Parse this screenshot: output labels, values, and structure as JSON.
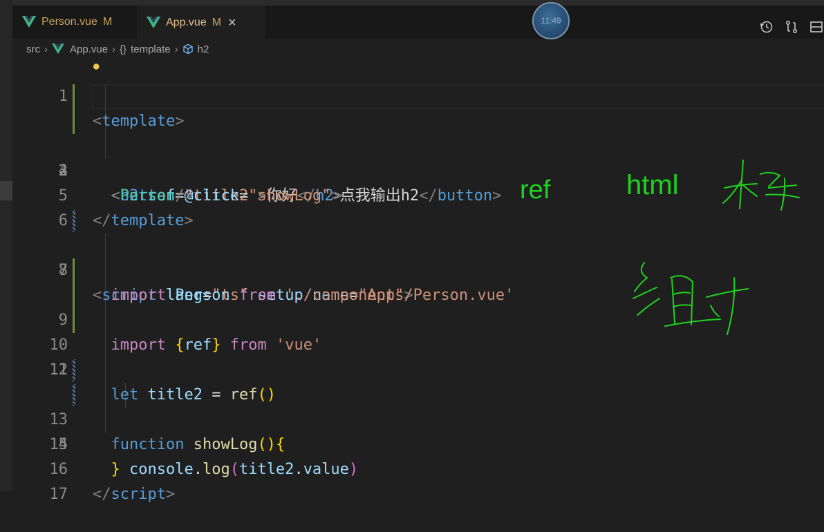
{
  "tabs": [
    {
      "name": "Person.vue",
      "status": "M",
      "active": false
    },
    {
      "name": "App.vue",
      "status": "M",
      "active": true,
      "close": "×"
    }
  ],
  "avatar_text": "11:49",
  "breadcrumb": {
    "folder": "src",
    "file": "App.vue",
    "node1": "template",
    "node1_icon": "{}",
    "node2": "h2"
  },
  "toolbar_icons": [
    "history-icon",
    "git-compare-icon",
    "split-editor-icon"
  ],
  "line_numbers": [
    "1",
    "2",
    "3",
    "4",
    "5",
    "6",
    "7",
    "8",
    "9",
    "10",
    "11",
    "12",
    "13",
    "14",
    "15",
    "16",
    "17"
  ],
  "current_line": 2,
  "code": {
    "l1": {
      "open": "<",
      "tag": "template",
      "close": ">"
    },
    "l2": {
      "open": "<",
      "tag": "h2",
      "attr": "ref",
      "eq": "=",
      "val": "\"title2\"",
      "gt": ">",
      "text": "你好",
      "endopen": "</",
      "endtag": "h2",
      "endclose": ">"
    },
    "l3": {
      "open": "<",
      "tag": "button",
      "attr": "@click",
      "eq": "=",
      "val": "\"showLog\"",
      "gt": ">",
      "text": "点我输出h2",
      "endopen": "</",
      "endtag": "button",
      "endclose": ">"
    },
    "l4": {
      "open": "<",
      "comp": "Person",
      "close": "/>"
    },
    "l5": {
      "open": "</",
      "tag": "template",
      "close": ">"
    },
    "l7": {
      "open": "<",
      "tag": "script",
      "a1": "lang",
      "v1": "\"ts\"",
      "a2": "setup",
      "a3": "name",
      "v3": "\"App\"",
      "close": ">",
      "eq": "="
    },
    "l8": {
      "kw": "import",
      "name": "Person",
      "from": "from",
      "str": "'./components/Person.vue'"
    },
    "l9": {
      "kw": "import",
      "lb": "{",
      "name": "ref",
      "rb": "}",
      "from": "from",
      "str": "'vue'"
    },
    "l11": {
      "kw": "let",
      "name": "title2",
      "op": "=",
      "fn": "ref",
      "parens": "()"
    },
    "l13": {
      "kw": "function",
      "fn": "showLog",
      "parens": "()",
      "brace": "{"
    },
    "l14": {
      "obj": "console",
      "dot": ".",
      "fn": "log",
      "lp": "(",
      "arg": "title2",
      "dot2": ".",
      "prop": "value",
      "rp": ")"
    },
    "l15": {
      "brace": "}"
    },
    "l16": {
      "open": "</",
      "tag": "script",
      "close": ">"
    }
  },
  "annotations": {
    "ref": "ref",
    "html": "html"
  },
  "colors": {
    "background": "#1f1f1f",
    "annotation_green": "#1ed31e",
    "tab_modified": "#e2c08d"
  }
}
